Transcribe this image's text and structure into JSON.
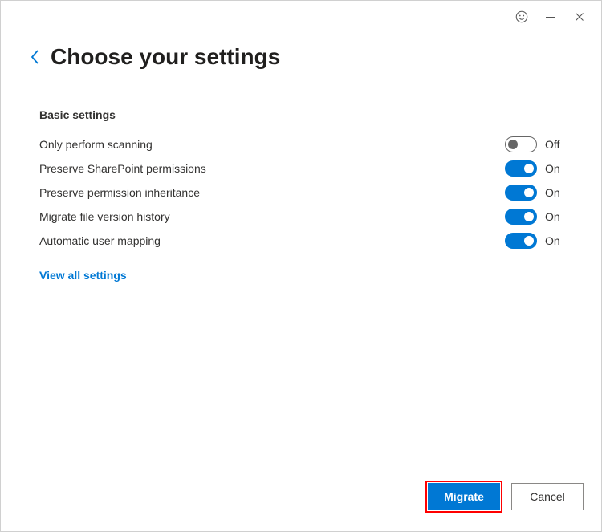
{
  "header": {
    "title": "Choose your settings"
  },
  "section": {
    "title": "Basic settings"
  },
  "toggle_labels": {
    "on": "On",
    "off": "Off"
  },
  "settings": [
    {
      "label": "Only perform scanning",
      "state": "off"
    },
    {
      "label": "Preserve SharePoint permissions",
      "state": "on"
    },
    {
      "label": "Preserve permission inheritance",
      "state": "on"
    },
    {
      "label": "Migrate file version history",
      "state": "on"
    },
    {
      "label": "Automatic user mapping",
      "state": "on"
    }
  ],
  "links": {
    "view_all": "View all settings"
  },
  "footer": {
    "primary": "Migrate",
    "secondary": "Cancel"
  }
}
